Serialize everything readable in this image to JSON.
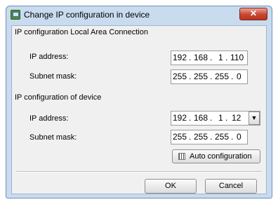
{
  "window": {
    "title": "Change IP configuration in device",
    "close_label": "✕"
  },
  "local_section": {
    "heading": "IP configuration Local Area Connection",
    "ip_label": "IP address:",
    "ip_value": [
      "192",
      "168",
      "1",
      "110"
    ],
    "mask_label": "Subnet mask:",
    "mask_value": [
      "255",
      "255",
      "255",
      "0"
    ]
  },
  "device_section": {
    "heading": "IP configuration of device",
    "ip_label": "IP address:",
    "ip_value": [
      "192",
      "168",
      "1",
      "12"
    ],
    "dropdown_icon": "▼",
    "mask_label": "Subnet mask:",
    "mask_value": [
      "255",
      "255",
      "255",
      "0"
    ],
    "auto_button": "Auto configuration"
  },
  "footer": {
    "ok_label": "OK",
    "cancel_label": "Cancel"
  }
}
